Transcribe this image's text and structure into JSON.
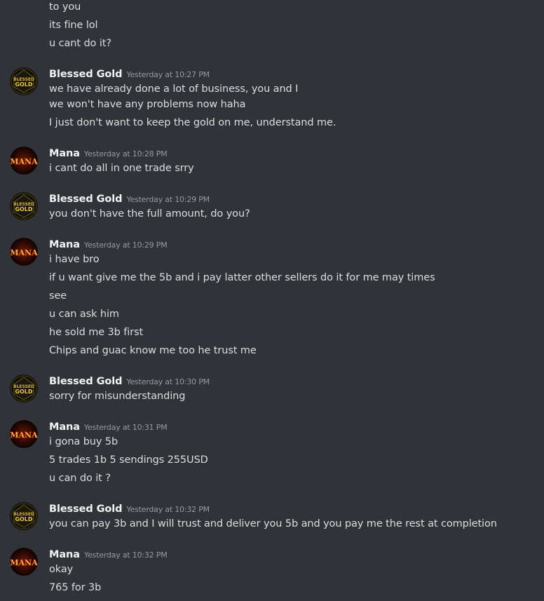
{
  "messages": {
    "m0": {
      "lines": [
        "to you",
        "its fine lol",
        "u cant do it?"
      ]
    },
    "m1": {
      "author": "Blessed Gold",
      "time": "Yesterday at 10:27 PM",
      "lines": [
        "we have already done a lot of business, you and I",
        "we won't have any problems now haha",
        "I just don't want to keep the gold on me, understand me."
      ]
    },
    "m2": {
      "author": "Mana",
      "time": "Yesterday at 10:28 PM",
      "lines": [
        "i cant do all in one trade srry"
      ]
    },
    "m3": {
      "author": "Blessed Gold",
      "time": "Yesterday at 10:29 PM",
      "lines": [
        "you don't have the full amount, do you?"
      ]
    },
    "m4": {
      "author": "Mana",
      "time": "Yesterday at 10:29 PM",
      "lines": [
        "i have bro",
        "if u want give me the 5b and i pay latter other sellers do it for me may times",
        "see",
        "u can ask him",
        "he sold me 3b first",
        "Chips and guac know me too he trust me"
      ]
    },
    "m5": {
      "author": "Blessed Gold",
      "time": "Yesterday at 10:30 PM",
      "lines": [
        "sorry for misunderstanding"
      ]
    },
    "m6": {
      "author": "Mana",
      "time": "Yesterday at 10:31 PM",
      "lines": [
        "i gona buy 5b",
        "5 trades 1b 5 sendings 255USD",
        "u can do it ?"
      ]
    },
    "m7": {
      "author": "Blessed Gold",
      "time": "Yesterday at 10:32 PM",
      "lines": [
        "you can pay 3b and I will trust and deliver you 5b and you pay me the rest at completion"
      ]
    },
    "m8": {
      "author": "Mana",
      "time": "Yesterday at 10:32 PM",
      "lines": [
        "okay",
        "765 for 3b"
      ]
    }
  },
  "avatars": {
    "blessed_gold_text_1": "BLESSED",
    "blessed_gold_text_2": "GOLD",
    "mana_text": "MANA"
  }
}
